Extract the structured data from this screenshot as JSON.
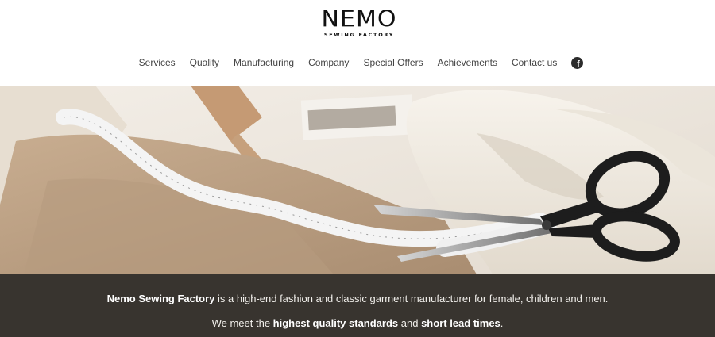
{
  "brand": {
    "name": "NEMO",
    "tagline": "SEWING FACTORY"
  },
  "nav": {
    "items": [
      {
        "label": "Services"
      },
      {
        "label": "Quality"
      },
      {
        "label": "Manufacturing"
      },
      {
        "label": "Company"
      },
      {
        "label": "Special Offers"
      },
      {
        "label": "Achievements"
      },
      {
        "label": "Contact us"
      }
    ],
    "social_icon": "facebook-icon"
  },
  "hero": {
    "image": "tailoring-scissors-measuring-tape-fabric",
    "slides": 3,
    "active_slide": 1
  },
  "info": {
    "line1_strong": "Nemo Sewing Factory",
    "line1_rest": " is a high-end fashion and classic garment manufacturer for female, children and men.",
    "line2_pre": "We meet the ",
    "line2_strong1": "highest quality standards",
    "line2_mid": " and ",
    "line2_strong2": "short lead times",
    "line2_end": "."
  },
  "colors": {
    "info_background": "#38342f",
    "info_text": "#f2f0ec",
    "nav_text": "#444444"
  }
}
